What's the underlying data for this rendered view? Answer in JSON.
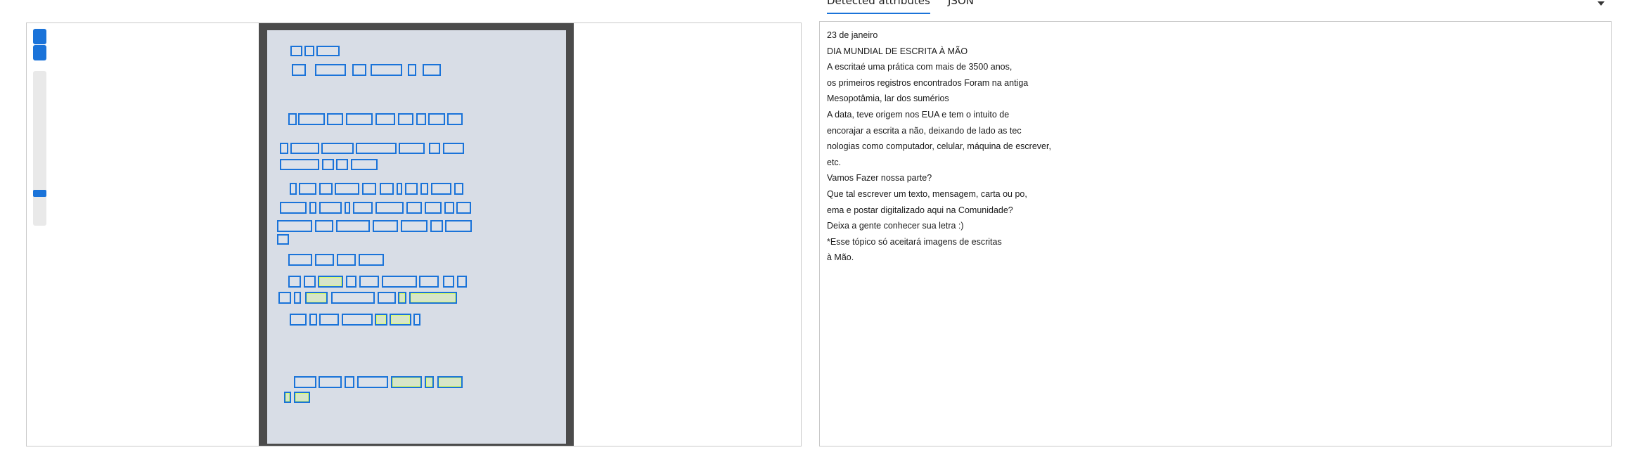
{
  "tabs": {
    "detected_label": "Detected attributes",
    "json_label": "JSON"
  },
  "colors": {
    "accent": "#1a73d9",
    "highlight": "#c8ff5a",
    "paper": "#d8dde6",
    "backdrop": "#4b4b4b"
  },
  "icons": {
    "dropdown": "chevron-down-icon"
  },
  "detected_text": [
    "23 de janeiro",
    "DIA MUNDIAL DE ESCRITA À MÃO",
    "A escritaé uma prática com mais de 3500 anos,",
    "os primeiros registros encontrados Foram na antiga",
    "Mesopotâmia, lar dos sumérios",
    "A data, teve origem nos EUA e tem o intuito de",
    "encorajar a escrita a não, deixando de lado as tec",
    "nologias como computador, celular, máquina de escrever,",
    "etc.",
    "Vamos Fazer nossa parte?",
    "Que tal escrever um texto, mensagem, carta ou po,",
    "ema e postar digitalizado aqui na Comunidade?",
    "Deixa a gente conhecer sua letra :)",
    "*Esse tópico só aceitará imagens de escritas",
    "à Mão."
  ]
}
